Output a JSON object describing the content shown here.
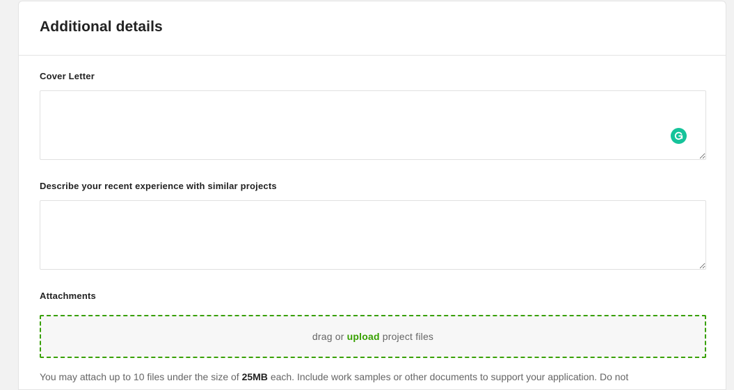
{
  "section": {
    "title": "Additional details"
  },
  "cover_letter": {
    "label": "Cover Letter",
    "value": ""
  },
  "experience": {
    "label": "Describe your recent experience with similar projects",
    "value": ""
  },
  "attachments": {
    "label": "Attachments",
    "drop_prefix": "drag or",
    "upload_link": "upload",
    "drop_suffix": "project files",
    "help_prefix": "You may attach up to 10 files under the size of",
    "help_size": "25MB",
    "help_suffix": "each. Include work samples or other documents to support your application. Do not"
  },
  "icons": {
    "grammarly": "grammarly-icon"
  },
  "colors": {
    "accent_green": "#37a000",
    "grammarly_green": "#15c39a",
    "border": "#e0e0e0"
  }
}
